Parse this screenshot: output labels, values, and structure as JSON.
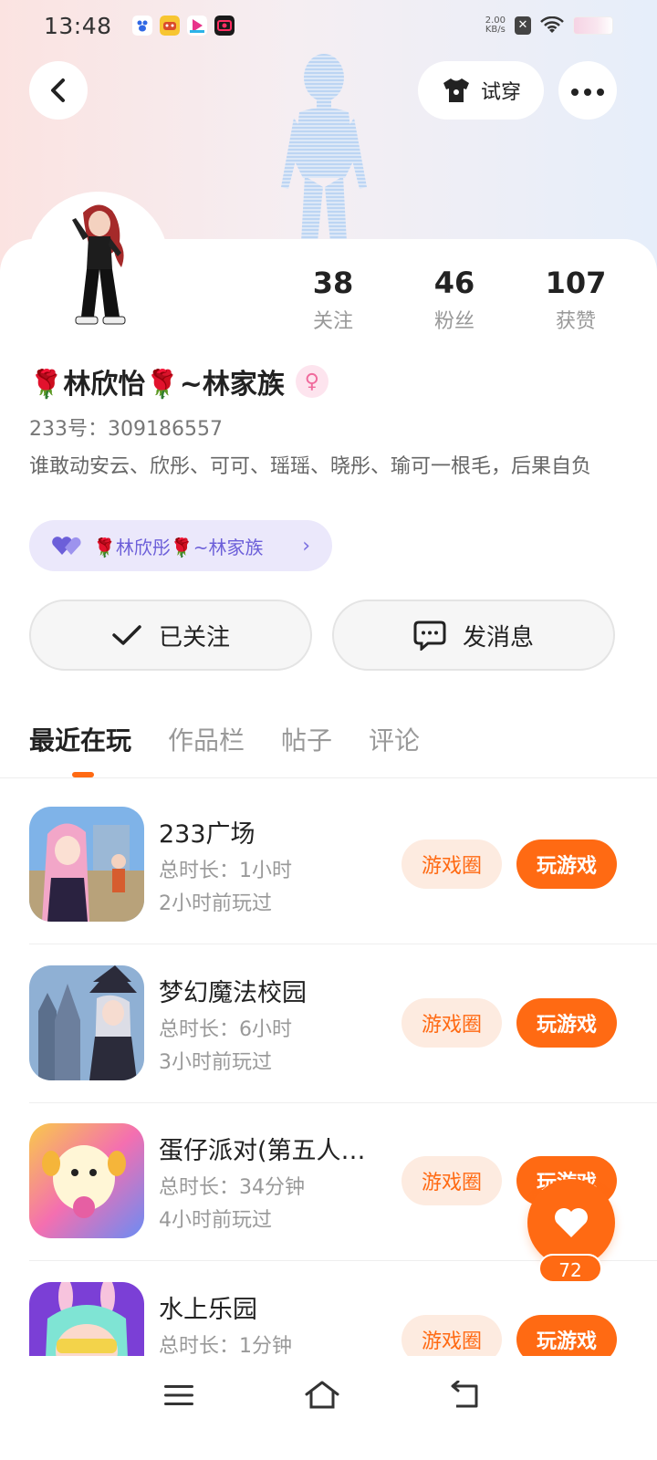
{
  "status_bar": {
    "time": "13:48",
    "net_speed_value": "2.00",
    "net_speed_unit": "KB/s",
    "icons": [
      "baidu-app-icon",
      "game-app-icon",
      "video-app-icon",
      "camera-app-icon",
      "close-badge-icon",
      "wifi-icon",
      "battery-icon"
    ]
  },
  "header": {
    "try_on_label": "试穿"
  },
  "stats": [
    {
      "value": "38",
      "label": "关注"
    },
    {
      "value": "46",
      "label": "粉丝"
    },
    {
      "value": "107",
      "label": "获赞"
    }
  ],
  "profile": {
    "nickname": "🌹林欣怡🌹~林家族",
    "gender_symbol": "♀",
    "uid": "233号：309186557",
    "bio": "谁敢动安云、欣彤、可可、瑶瑶、晓彤、瑜可一根毛，后果自负",
    "family_chip_label": "🌹林欣彤🌹~林家族"
  },
  "actions": {
    "follow_label": "已关注",
    "message_label": "发消息"
  },
  "tabs": [
    "最近在玩",
    "作品栏",
    "帖子",
    "评论"
  ],
  "games": [
    {
      "name": "233广场",
      "duration": "总时长：1小时",
      "last_played": "2小时前玩过",
      "circle_label": "游戏圈",
      "play_label": "玩游戏"
    },
    {
      "name": "梦幻魔法校园",
      "duration": "总时长：6小时",
      "last_played": "3小时前玩过",
      "circle_label": "游戏圈",
      "play_label": "玩游戏"
    },
    {
      "name": "蛋仔派对(第五人…",
      "duration": "总时长：34分钟",
      "last_played": "4小时前玩过",
      "circle_label": "游戏圈",
      "play_label": "玩游戏"
    },
    {
      "name": "水上乐园",
      "duration": "总时长：1分钟",
      "last_played": "",
      "circle_label": "游戏圈",
      "play_label": "玩游戏"
    }
  ],
  "like_count": "72",
  "colors": {
    "accent": "#ff6a13",
    "accent_soft": "#fdebe0",
    "family_chip_bg": "#ebe8fb",
    "family_chip_text": "#6c5fd9"
  }
}
